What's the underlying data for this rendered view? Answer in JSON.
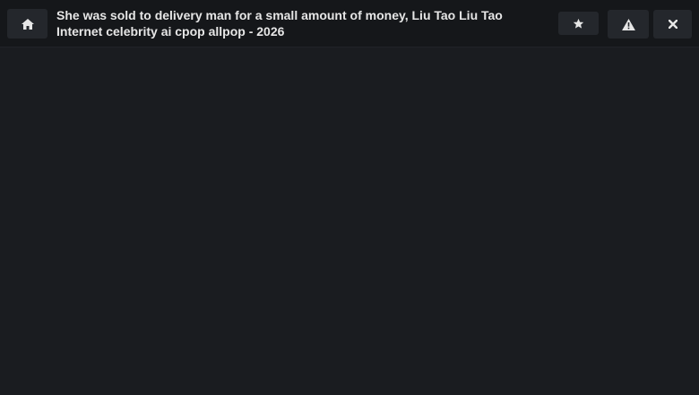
{
  "header": {
    "title": "She was sold to delivery man for a small amount of money, Liu Tao Liu Tao Internet celebrity ai cpop allpop - 2026"
  },
  "icons": {
    "home": "home-icon",
    "star": "star-icon",
    "warning": "warning-icon",
    "close": "close-icon"
  },
  "colors": {
    "background": "#1a1c20",
    "topbar": "#15171a",
    "button": "#24272c",
    "text": "#e6e6e6"
  }
}
